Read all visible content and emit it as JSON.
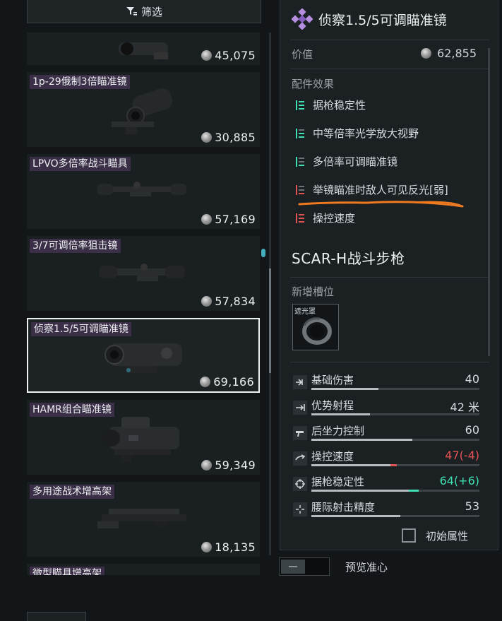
{
  "filter": {
    "label": "筛选"
  },
  "items": [
    {
      "label": "",
      "price": "45,075"
    },
    {
      "label": "1p-29俄制3倍瞄准镜",
      "price": "30,885"
    },
    {
      "label": "LPVO多倍率战斗瞄具",
      "price": "57,169"
    },
    {
      "label": "3/7可调倍率狙击镜",
      "price": "57,834"
    },
    {
      "label": "侦察1.5/5可调瞄准镜",
      "price": "69,166",
      "selected": true
    },
    {
      "label": "HAMR组合瞄准镜",
      "price": "59,349"
    },
    {
      "label": "多用途战术增高架",
      "price": "18,135"
    },
    {
      "label": "微型瞄具增高架",
      "price": ""
    }
  ],
  "detail": {
    "title": "侦察1.5/5可调瞄准镜",
    "value_label": "价值",
    "value": "62,855",
    "effects_heading": "配件效果",
    "effects": [
      {
        "text": "据枪稳定性",
        "kind": "positive"
      },
      {
        "text": "中等倍率光学放大视野",
        "kind": "positive"
      },
      {
        "text": "多倍率可调瞄准镜",
        "kind": "positive"
      },
      {
        "text": "举镜瞄准时敌人可见反光[弱]",
        "kind": "negative"
      },
      {
        "text": "操控速度",
        "kind": "negative"
      }
    ],
    "weapon_name": "SCAR-H战斗步枪",
    "slot_heading": "新增槽位",
    "slot_item": "遮光罩",
    "stats": [
      {
        "name": "基础伤害",
        "value": "40",
        "level": 0.4,
        "color": "normal",
        "icon": "damage-icon"
      },
      {
        "name": "优势射程",
        "value": "42 米",
        "level": 0.35,
        "color": "normal",
        "icon": "range-icon"
      },
      {
        "name": "后坐力控制",
        "value": "60",
        "level": 0.6,
        "color": "normal",
        "icon": "recoil-icon"
      },
      {
        "name": "操控速度",
        "value": "47(-4)",
        "level": 0.47,
        "delta": -0.04,
        "color": "red",
        "icon": "handling-icon"
      },
      {
        "name": "据枪稳定性",
        "value": "64(+6)",
        "level": 0.58,
        "delta": 0.06,
        "color": "green",
        "icon": "stability-icon"
      },
      {
        "name": "腰际射击精度",
        "value": "53",
        "level": 0.53,
        "color": "normal",
        "icon": "hipfire-icon"
      }
    ],
    "partial_text": "初始属性"
  },
  "preview": {
    "label": "预览准心"
  },
  "colors": {
    "positive": "#3fe0b3",
    "negative": "#e25353",
    "highlight_stroke": "#f07a1f",
    "label_bg": "#3b2f47"
  }
}
